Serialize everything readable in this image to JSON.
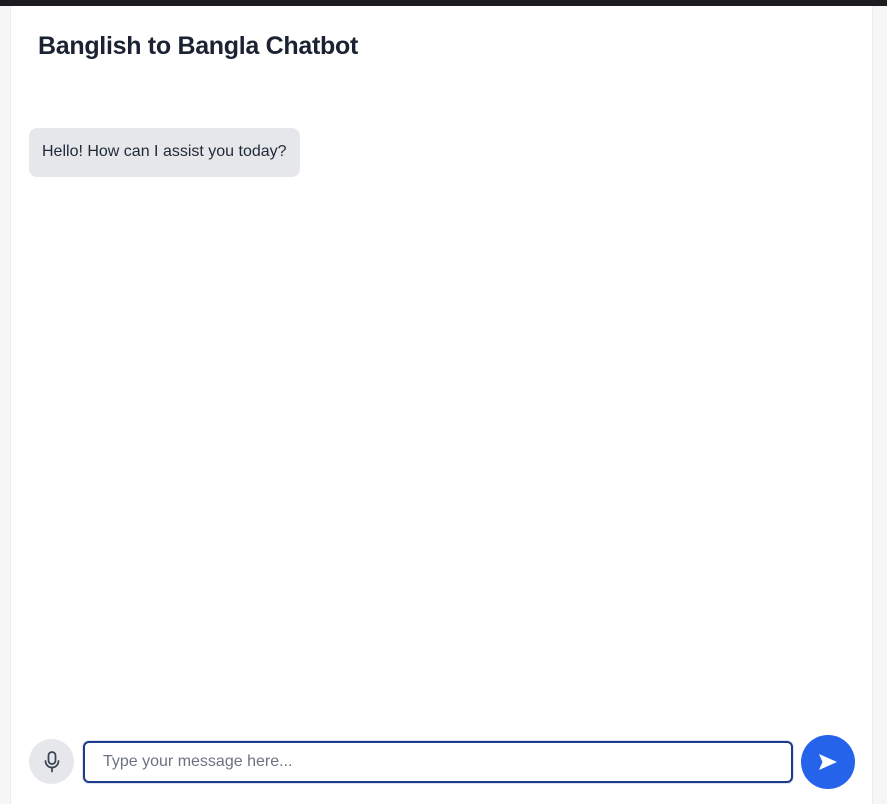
{
  "header": {
    "title": "Banglish to Bangla Chatbot"
  },
  "messages": [
    {
      "sender": "bot",
      "text": "Hello! How can I assist you today?"
    }
  ],
  "composer": {
    "placeholder": "Type your message here...",
    "value": "",
    "mic_icon": "microphone-icon",
    "send_icon": "send-arrow-icon"
  },
  "colors": {
    "accent": "#2563eb",
    "bubble_bg": "#e5e7eb",
    "input_border": "#1e3a8a",
    "title": "#1b2232"
  }
}
